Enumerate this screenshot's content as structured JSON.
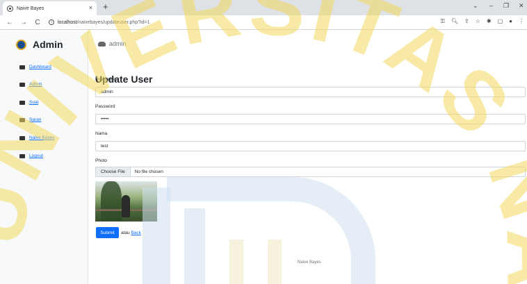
{
  "browser": {
    "tab_title": "Naive Bayes",
    "tab_close": "×",
    "new_tab": "+",
    "url_host": "localhost",
    "url_path": "/naivebayes/updateuser.php?id=1",
    "back": "←",
    "forward": "→",
    "reload": "C",
    "info": "i",
    "window_controls": {
      "chevron": "⌄",
      "minimize": "–",
      "maximize": "❐",
      "close": "✕"
    }
  },
  "sidebar": {
    "brand": "Admin",
    "items": [
      {
        "label": "Dashboard",
        "icon": "dashboard-icon"
      },
      {
        "label": "Admin",
        "icon": "user-icon"
      },
      {
        "label": "Soal",
        "icon": "folder-icon"
      },
      {
        "label": "Saran",
        "icon": "card-icon"
      },
      {
        "label": "Naive Bayes",
        "icon": "folder-icon"
      },
      {
        "label": "Logout",
        "icon": "logout-icon"
      }
    ]
  },
  "header": {
    "user": "admin"
  },
  "form": {
    "title": "Update User",
    "username_label": "Username",
    "username_value": "admin",
    "password_label": "Password",
    "password_value": "•••••",
    "nama_label": "Nama",
    "nama_value": "test",
    "photo_label": "Photo",
    "choose_file": "Choose File",
    "no_file": "No file chosen",
    "submit": "Submit",
    "atau": "atau",
    "back": "Back"
  },
  "footer": "Naive Bayes",
  "watermark": {
    "text": "UNIVERSITAS NAROTAMA",
    "color": "#f2d95c"
  }
}
